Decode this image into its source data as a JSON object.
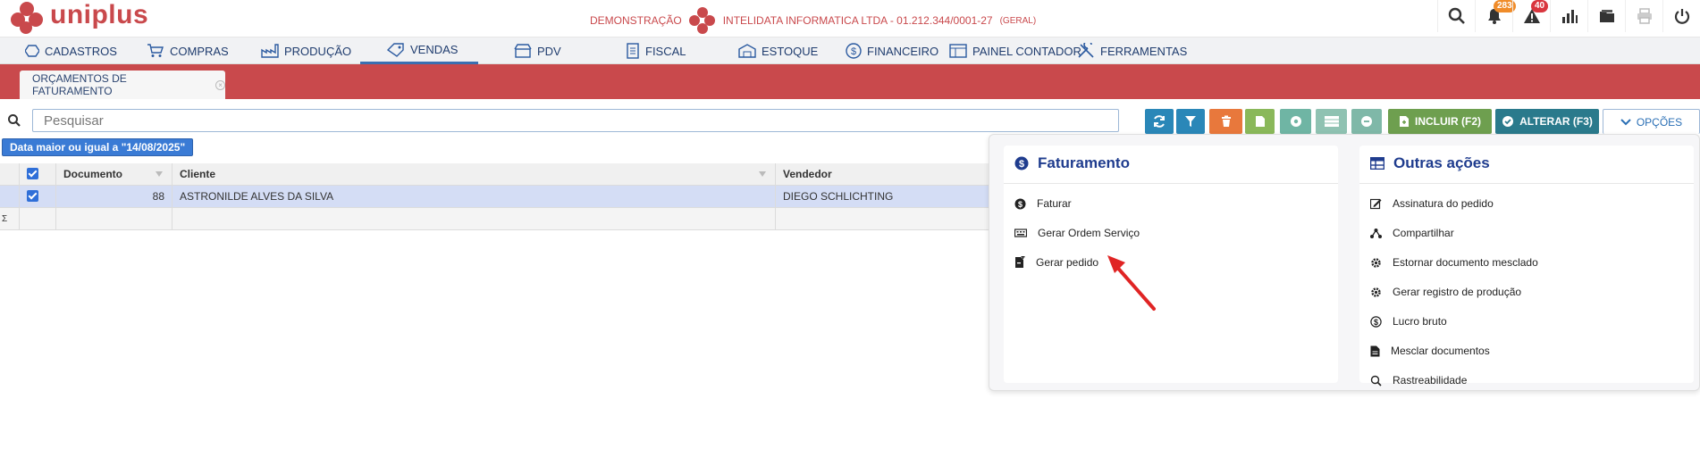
{
  "brand": {
    "name": "uniplus",
    "color": "#c9494c"
  },
  "company": {
    "prefix": "DEMONSTRAÇÃO",
    "name": "INTELIDATA INFORMATICA LTDA - 01.212.344/0001-27",
    "scope": "(GERAL)"
  },
  "top_icons": [
    {
      "name": "search-icon"
    },
    {
      "name": "bell-icon",
      "badge": "283",
      "badge_color": "#f08c2a"
    },
    {
      "name": "warning-icon",
      "badge": "40",
      "badge_color": "#d9363e"
    },
    {
      "name": "chart-icon"
    },
    {
      "name": "folder-icon"
    },
    {
      "name": "printer-icon"
    },
    {
      "name": "power-icon"
    }
  ],
  "menu": [
    {
      "label": "CADASTROS",
      "icon": "hexagon-icon"
    },
    {
      "label": "COMPRAS",
      "icon": "cart-icon"
    },
    {
      "label": "PRODUÇÃO",
      "icon": "factory-icon"
    },
    {
      "label": "VENDAS",
      "icon": "tag-icon",
      "active": true
    },
    {
      "label": "PDV",
      "icon": "store-icon"
    },
    {
      "label": "FISCAL",
      "icon": "document-icon"
    },
    {
      "label": "ESTOQUE",
      "icon": "warehouse-icon"
    },
    {
      "label": "FINANCEIRO",
      "icon": "dollar-icon"
    },
    {
      "label": "PAINEL CONTADOR",
      "icon": "panel-icon"
    },
    {
      "label": "FERRAMENTAS",
      "icon": "tools-icon"
    }
  ],
  "tab": {
    "label": "ORÇAMENTOS DE FATURAMENTO"
  },
  "search": {
    "placeholder": "Pesquisar"
  },
  "toolbar": {
    "include_label": "INCLUIR (F2)",
    "alter_label": "ALTERAR (F3)",
    "options_label": "OPÇÕES",
    "colors": {
      "refresh": "#2a87b8",
      "filter": "#2a87b8",
      "delete": "#e8783c",
      "green": "#8ab85a",
      "teal": "#6fb5a4",
      "include": "#6e9f4f",
      "alter": "#2a7a8c"
    }
  },
  "filter_chip": "Data maior ou igual a \"14/08/2025\"",
  "table": {
    "columns": {
      "document": "Documento",
      "client": "Cliente",
      "seller": "Vendedor"
    },
    "rows": [
      {
        "document": "88",
        "client": "ASTRONILDE ALVES DA SILVA",
        "seller": "DIEGO SCHLICHTING",
        "selected": true
      }
    ],
    "footer_symbol": "Σ"
  },
  "dropdown": {
    "billing": {
      "title": "Faturamento",
      "items": [
        {
          "label": "Faturar",
          "icon": "dollar-circle-icon"
        },
        {
          "label": "Gerar Ordem Serviço",
          "icon": "keyboard-icon"
        },
        {
          "label": "Gerar pedido",
          "icon": "file-add-icon"
        }
      ]
    },
    "other": {
      "title": "Outras ações",
      "items": [
        {
          "label": "Assinatura do pedido",
          "icon": "signature-icon"
        },
        {
          "label": "Compartilhar",
          "icon": "share-icon"
        },
        {
          "label": "Estornar documento mesclado",
          "icon": "gear-icon"
        },
        {
          "label": "Gerar registro de produção",
          "icon": "gear-icon"
        },
        {
          "label": "Lucro bruto",
          "icon": "dollar-circle-icon"
        },
        {
          "label": "Mesclar documentos",
          "icon": "file-icon"
        },
        {
          "label": "Rastreabilidade",
          "icon": "search-icon"
        }
      ]
    }
  }
}
